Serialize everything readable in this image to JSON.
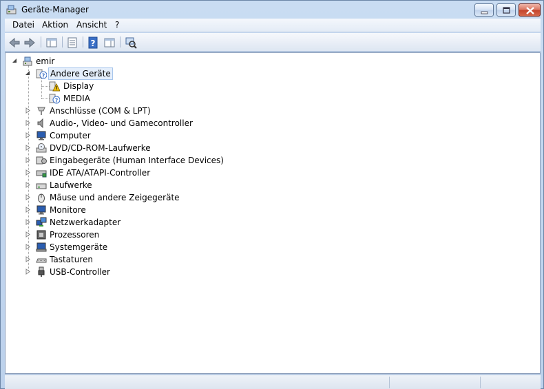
{
  "window": {
    "title": "Geräte-Manager",
    "icon": "device-manager-icon"
  },
  "menu": {
    "items": [
      "Datei",
      "Aktion",
      "Ansicht",
      "?"
    ]
  },
  "toolbar": {
    "buttons": [
      "back-icon",
      "forward-icon",
      "show-hide-tree-icon",
      "properties-icon",
      "help-icon",
      "console-view-icon",
      "scan-hardware-icon"
    ]
  },
  "tree": {
    "root": {
      "label": "emir",
      "expanded": true,
      "icon": "computer-icon"
    },
    "groups": [
      {
        "label": "Andere Geräte",
        "expanded": true,
        "selected": true,
        "icon": "unknown-device-icon",
        "children": [
          {
            "label": "Display",
            "icon": "warning-device-icon"
          },
          {
            "label": "MEDIA",
            "icon": "unknown-device-icon"
          }
        ]
      },
      {
        "label": "Anschlüsse (COM & LPT)",
        "icon": "port-icon"
      },
      {
        "label": "Audio-, Video- und Gamecontroller",
        "icon": "speaker-icon"
      },
      {
        "label": "Computer",
        "icon": "monitor-icon"
      },
      {
        "label": "DVD/CD-ROM-Laufwerke",
        "icon": "optical-drive-icon"
      },
      {
        "label": "Eingabegeräte (Human Interface Devices)",
        "icon": "hid-icon"
      },
      {
        "label": "IDE ATA/ATAPI-Controller",
        "icon": "ide-controller-icon"
      },
      {
        "label": "Laufwerke",
        "icon": "disk-drive-icon"
      },
      {
        "label": "Mäuse und andere Zeigegeräte",
        "icon": "mouse-icon"
      },
      {
        "label": "Monitore",
        "icon": "monitor-icon"
      },
      {
        "label": "Netzwerkadapter",
        "icon": "network-adapter-icon"
      },
      {
        "label": "Prozessoren",
        "icon": "processor-icon"
      },
      {
        "label": "Systemgeräte",
        "icon": "system-device-icon"
      },
      {
        "label": "Tastaturen",
        "icon": "keyboard-icon"
      },
      {
        "label": "USB-Controller",
        "icon": "usb-icon"
      }
    ]
  },
  "colors": {
    "selection_bg": "#e4eefb",
    "selection_border": "#a8c6ec",
    "frame": "#c9dcf2",
    "close_button": "#c3432b"
  }
}
